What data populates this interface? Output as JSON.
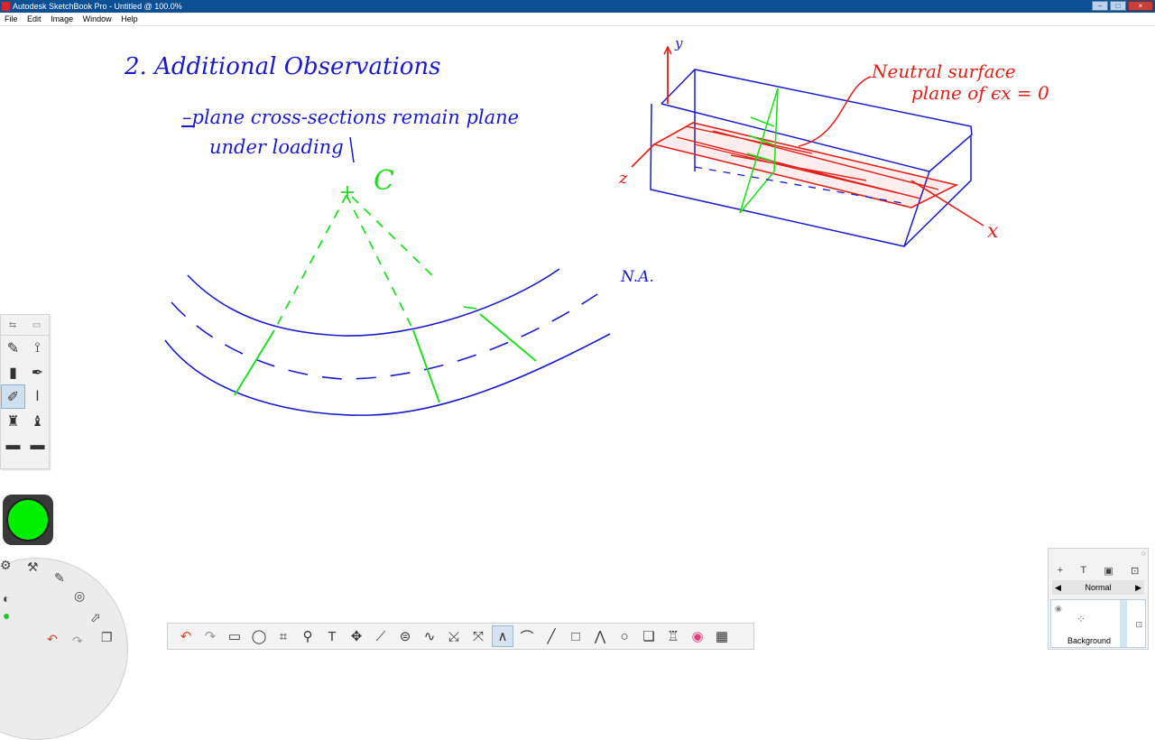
{
  "window": {
    "title": "Autodesk SketchBook Pro - Untitled @ 100.0%",
    "controls": [
      "–",
      "□",
      "×"
    ]
  },
  "menu": [
    "File",
    "Edit",
    "Image",
    "Window",
    "Help"
  ],
  "canvas": {
    "heading": "2.   Additional   Observations",
    "bullet_line1": "–plane cross-sections remain plane",
    "bullet_line2": "under loading",
    "center_label": "C",
    "na_label": "N.A.",
    "annotation_line1": "Neutral surface",
    "annotation_line2": "plane of ϵx = 0",
    "axis_y": "y",
    "axis_z": "z",
    "axis_x": "x"
  },
  "colors": {
    "ink_blue": "#1a1ac8",
    "ink_green": "#22dd22",
    "ink_red": "#e0201a",
    "current_color": "#00f000"
  },
  "toolpanel": {
    "icons": [
      "brush-settings-icon",
      "brush-palette-icon",
      "pencil-icon",
      "airbrush-icon",
      "marker-icon",
      "pen-icon",
      "ballpoint-pen-icon",
      "fine-pen-icon",
      "felt-pen-icon",
      "chisel-icon",
      "eraser-icon",
      "hard-eraser-icon"
    ]
  },
  "bottom_toolbar": {
    "icons": [
      "undo-icon",
      "redo-icon",
      "rect-select-icon",
      "lasso-icon",
      "crop-icon",
      "zoom-icon",
      "text-icon",
      "move-icon",
      "ruler-icon",
      "ellipse-guide-icon",
      "french-curve-icon",
      "symmetry-x-icon",
      "symmetry-y-icon",
      "stroke-icon",
      "curve-icon",
      "line-icon",
      "rectangle-icon",
      "polyline-icon",
      "ellipse-icon",
      "copy-paste-icon",
      "brush-icon",
      "color-wheel-icon",
      "layers-icon"
    ]
  },
  "layer_panel": {
    "blend_mode": "Normal",
    "layer_name": "Background"
  }
}
